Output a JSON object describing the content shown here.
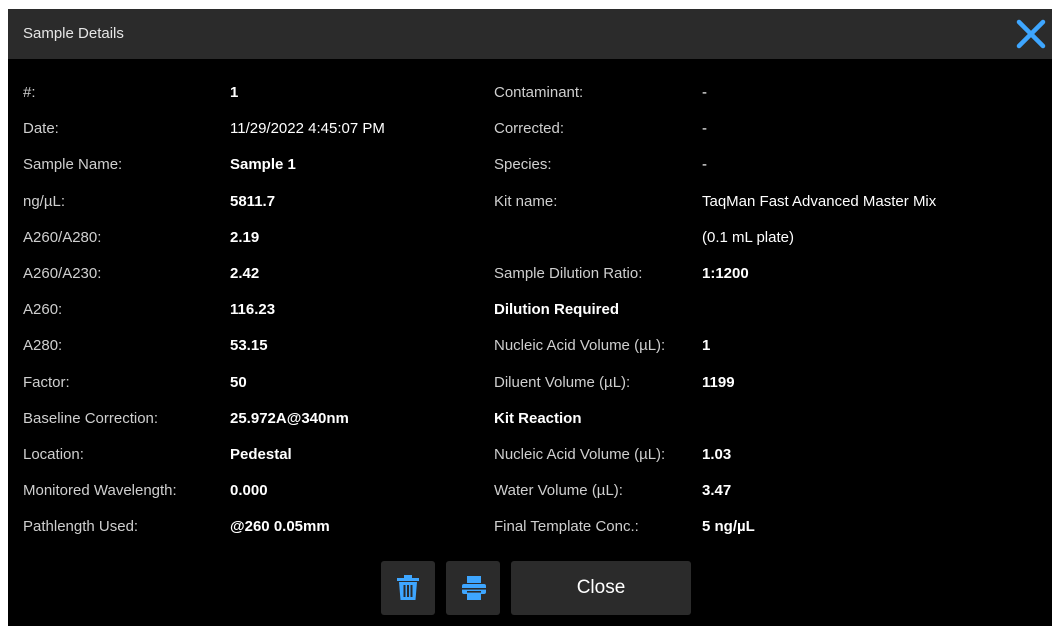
{
  "window": {
    "title": "Sample Details"
  },
  "left": [
    {
      "label": "#:",
      "value": "1",
      "bold": true
    },
    {
      "label": "Date:",
      "value": "11/29/2022 4:45:07 PM",
      "bold": false
    },
    {
      "label": "Sample Name:",
      "value": "Sample 1",
      "bold": true
    },
    {
      "label": "ng/µL:",
      "value": "5811.7",
      "bold": true
    },
    {
      "label": "A260/A280:",
      "value": "2.19",
      "bold": true
    },
    {
      "label": "A260/A230:",
      "value": "2.42",
      "bold": true
    },
    {
      "label": "A260:",
      "value": "116.23",
      "bold": true
    },
    {
      "label": "A280:",
      "value": "53.15",
      "bold": true
    },
    {
      "label": "Factor:",
      "value": "50",
      "bold": true
    },
    {
      "label": "Baseline Correction:",
      "value": "25.972A@340nm",
      "bold": true
    },
    {
      "label": "Location:",
      "value": "Pedestal",
      "bold": true
    },
    {
      "label": "Monitored Wavelength:",
      "value": "0.000",
      "bold": true
    },
    {
      "label": "Pathlength Used:",
      "value": "@260 0.05mm",
      "bold": true
    }
  ],
  "right": [
    {
      "label": "Contaminant:",
      "value": "-",
      "bold": false
    },
    {
      "label": "Corrected:",
      "value": "-",
      "bold": false
    },
    {
      "label": "Species:",
      "value": "-",
      "bold": false
    },
    {
      "label": "Kit name:",
      "value": "TaqMan Fast Advanced Master Mix",
      "bold": false
    },
    {
      "label": "",
      "value": "(0.1 mL plate)",
      "bold": false
    },
    {
      "label": "Sample Dilution Ratio:",
      "value": "1:1200",
      "bold": true
    },
    {
      "label": "Dilution Required",
      "value": "",
      "heading": true
    },
    {
      "label": "Nucleic Acid Volume (µL):",
      "value": "1",
      "bold": true
    },
    {
      "label": "Diluent Volume (µL):",
      "value": "1199",
      "bold": true
    },
    {
      "label": "Kit Reaction",
      "value": "",
      "heading": true
    },
    {
      "label": "Nucleic Acid Volume (µL):",
      "value": "1.03",
      "bold": true
    },
    {
      "label": "Water Volume (µL):",
      "value": "3.47",
      "bold": true
    },
    {
      "label": "Final Template Conc.:",
      "value": "5 ng/µL",
      "bold": true
    }
  ],
  "footer": {
    "close_label": "Close"
  },
  "icons": {
    "title_close": "close-icon",
    "delete": "trash-icon",
    "print": "printer-icon"
  },
  "colors": {
    "accent": "#3ea6ff",
    "titlebar": "#2b2b2b",
    "background": "#000000"
  }
}
